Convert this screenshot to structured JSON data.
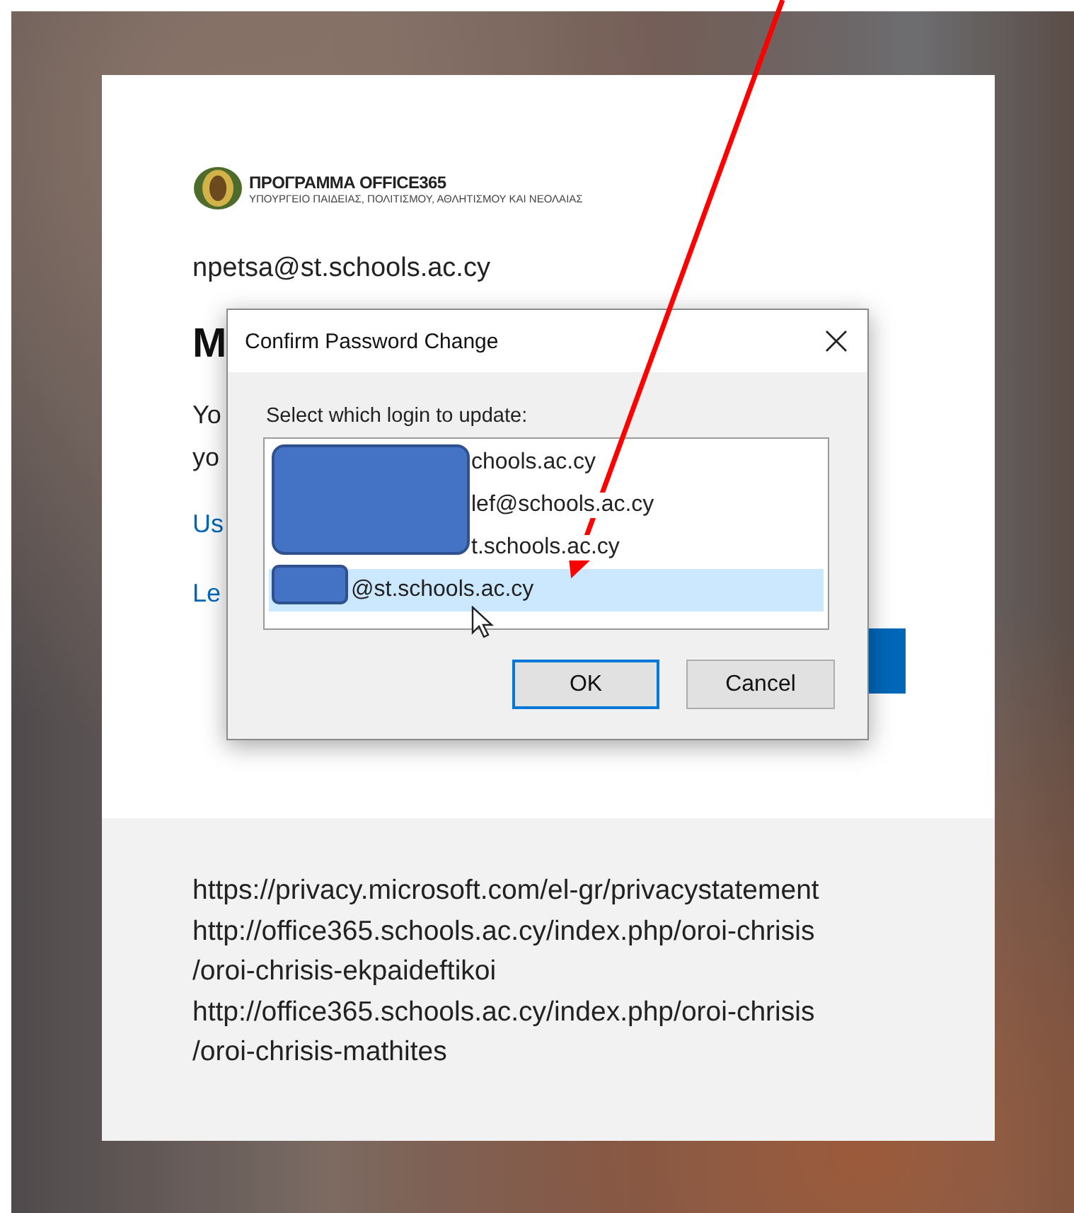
{
  "logo": {
    "title": "ΠΡΟΓΡΑΜΜΑ OFFICE365",
    "subtitle": "ΥΠΟΥΡΓΕΙΟ ΠΑΙΔΕΙΑΣ, ΠΟΛΙΤΙΣΜΟΥ, ΑΘΛΗΤΙΣΜΟΥ ΚΑΙ ΝΕΟΛΑΙΑΣ"
  },
  "account": "npetsa@st.schools.ac.cy",
  "heading": "M",
  "body_lines": [
    "Yo",
    "yo"
  ],
  "links": [
    "Us",
    "Le"
  ],
  "dialog": {
    "title": "Confirm Password Change",
    "prompt": "Select which login to update:",
    "logins": [
      {
        "text": "chools.ac.cy",
        "selected": false
      },
      {
        "text": "lef@schools.ac.cy",
        "selected": false
      },
      {
        "text": "t.schools.ac.cy",
        "selected": false
      },
      {
        "text": "@st.schools.ac.cy",
        "selected": true
      }
    ],
    "buttons": [
      {
        "label": "OK",
        "kind": "default"
      },
      {
        "label": "Cancel",
        "kind": "normal"
      }
    ]
  },
  "footer_lines": [
    "https://privacy.microsoft.com/el-gr/privacystatement",
    "http://office365.schools.ac.cy/index.php/oroi-chrisis",
    "/oroi-chrisis-ekpaideftikoi",
    "http://office365.schools.ac.cy/index.php/oroi-chrisis",
    "/oroi-chrisis-mathites"
  ]
}
